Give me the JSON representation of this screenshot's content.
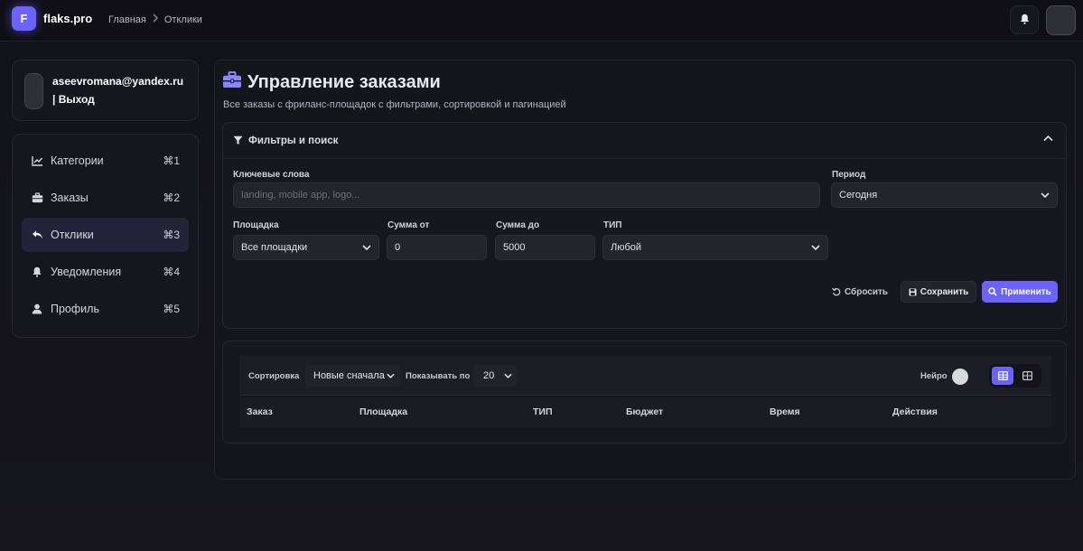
{
  "topbar": {
    "logo_letter": "F",
    "brand": "flaks.pro",
    "breadcrumb": [
      "Главная",
      "Отклики"
    ],
    "icons": {
      "bell": "bell-icon",
      "avatar": "avatar"
    }
  },
  "user": {
    "email": "aseevromana@yandex.ru",
    "logout": "| Выход"
  },
  "sidebar": {
    "items": [
      {
        "label": "Категории",
        "shortcut": "⌘1",
        "icon": "chart-line-icon",
        "active": false
      },
      {
        "label": "Заказы",
        "shortcut": "⌘2",
        "icon": "briefcase-icon",
        "active": false
      },
      {
        "label": "Отклики",
        "shortcut": "⌘3",
        "icon": "reply-icon",
        "active": true
      },
      {
        "label": "Уведомления",
        "shortcut": "⌘4",
        "icon": "bell-icon",
        "active": false
      },
      {
        "label": "Профиль",
        "shortcut": "⌘5",
        "icon": "user-icon",
        "active": false
      }
    ]
  },
  "page": {
    "title": "Управление заказами",
    "subtitle": "Все заказы с фриланс-площадок с фильтрами, сортировкой и пагинацией"
  },
  "filters": {
    "title": "Фильтры и поиск",
    "keywords": {
      "label": "Ключевые слова",
      "placeholder": "landing, mobile app, logo..."
    },
    "period": {
      "label": "Период",
      "value": "Сегодня"
    },
    "platform": {
      "label": "Площадка",
      "value": "Все площадки"
    },
    "sum_from": {
      "label": "Сумма от",
      "value": "0"
    },
    "sum_to": {
      "label": "Сумма до",
      "value": "5000"
    },
    "type": {
      "label": "ТИП",
      "value": "Любой"
    },
    "buttons": {
      "reset": "Сбросить",
      "save": "Сохранить",
      "apply": "Применить"
    }
  },
  "results": {
    "sort_label": "Сортировка",
    "sort_value": "Новые сначала",
    "show_label": "Показывать по",
    "show_value": "20",
    "neuro_label": "Нейро",
    "columns": [
      "Заказ",
      "Площадка",
      "ТИП",
      "Бюджет",
      "Время",
      "Действия"
    ]
  },
  "colors": {
    "accent": "#6c63ff",
    "background": "#12121a",
    "panel": "#17171f"
  }
}
